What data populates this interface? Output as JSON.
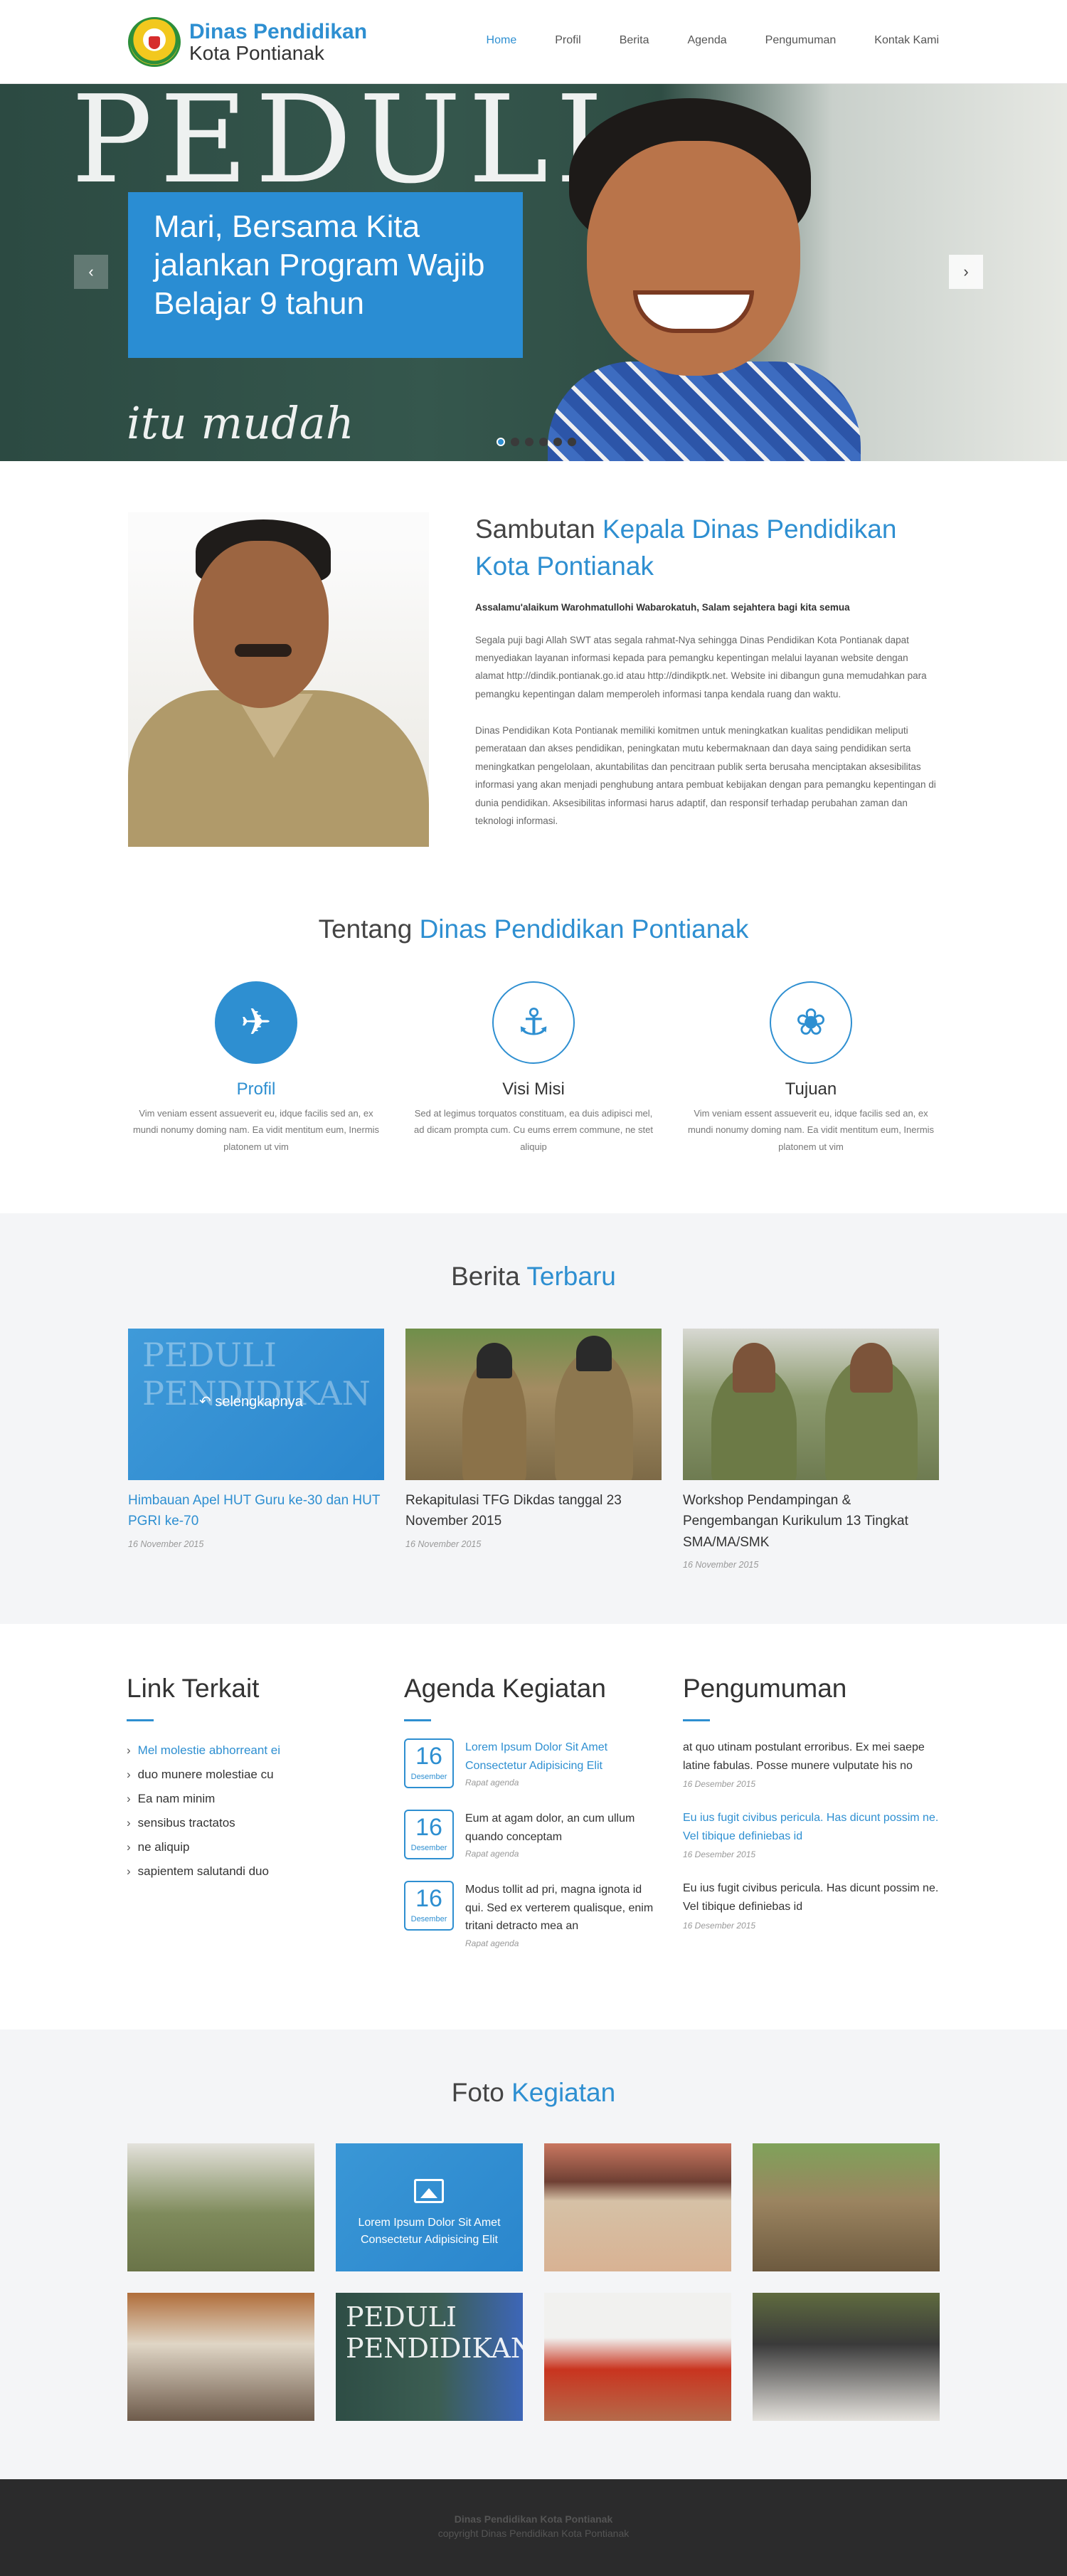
{
  "header": {
    "logo_title": "Dinas Pendidikan",
    "logo_sub": "Kota Pontianak",
    "nav": [
      {
        "label": "Home",
        "active": true
      },
      {
        "label": "Profil",
        "active": false
      },
      {
        "label": "Berita",
        "active": false
      },
      {
        "label": "Agenda",
        "active": false
      },
      {
        "label": "Pengumuman",
        "active": false
      },
      {
        "label": "Kontak Kami",
        "active": false
      }
    ]
  },
  "hero": {
    "caption": "Mari, Bersama Kita jalankan Program Wajib Belajar 9 tahun",
    "chalk_top": "PEDULI",
    "chalk_bottom": "itu mudah",
    "prev_icon": "chevron-left-icon",
    "next_icon": "chevron-right-icon",
    "slides": 6,
    "active_slide": 1
  },
  "welcome": {
    "title_plain": "Sambutan ",
    "title_blue": "Kepala Dinas Pendidikan Kota Pontianak",
    "greeting": "Assalamu'alaikum Warohmatullohi Wabarokatuh, Salam sejahtera bagi kita semua",
    "paragraph1": "Segala puji bagi Allah SWT atas segala rahmat-Nya sehingga Dinas Pendidikan Kota Pontianak dapat menyediakan layanan informasi kepada para pemangku kepentingan melalui layanan website dengan alamat http://dindik.pontianak.go.id atau http://dindikptk.net. Website ini dibangun guna memudahkan para pemangku kepentingan dalam memperoleh informasi tanpa kendala ruang dan waktu.",
    "paragraph2": "Dinas Pendidikan Kota Pontianak memiliki komitmen untuk meningkatkan kualitas pendidikan meliputi pemerataan dan akses pendidikan, peningkatan mutu kebermaknaan dan daya saing pendidikan serta meningkatkan pengelolaan, akuntabilitas dan pencitraan publik serta berusaha menciptakan aksesibilitas informasi yang akan menjadi penghubung antara pembuat kebijakan dengan para pemangku kepentingan di dunia pendidikan. Aksesibilitas informasi harus adaptif, dan responsif terhadap perubahan zaman dan teknologi informasi."
  },
  "tentang": {
    "title_plain": "Tentang ",
    "title_blue": "Dinas Pendidikan Pontianak",
    "items": [
      {
        "icon": "airplane-icon",
        "glyph": "✈",
        "title": "Profil",
        "text": "Vim veniam essent assueverit eu, idque facilis sed an, ex mundi nonumy doming nam. Ea vidit mentitum eum, Inermis platonem ut vim"
      },
      {
        "icon": "anchor-icon",
        "glyph": "⚓",
        "title": "Visi Misi",
        "text": "Sed at legimus torquatos constituam, ea duis adipisci mel, ad dicam prompta cum. Cu eums errem commune, ne stet aliquip"
      },
      {
        "icon": "bug-icon",
        "glyph": "❀",
        "title": "Tujuan",
        "text": "Vim veniam essent assueverit eu, idque facilis sed an, ex mundi nonumy doming nam. Ea vidit mentitum eum, Inermis platonem ut vim"
      }
    ]
  },
  "berita": {
    "title_plain": "Berita ",
    "title_blue": "Terbaru",
    "overlay_label": "selengkapnya",
    "items": [
      {
        "title": "Himbauan Apel HUT Guru ke-30 dan HUT PGRI ke-70",
        "date": "16 November 2015"
      },
      {
        "title": "Rekapitulasi TFG Dikdas tanggal 23 November 2015",
        "date": "16 November 2015"
      },
      {
        "title": "Workshop Pendampingan & Pengembangan Kurikulum 13 Tingkat SMA/MA/SMK",
        "date": "16 November 2015"
      }
    ]
  },
  "links": {
    "title": "Link Terkait",
    "items": [
      "Mel molestie abhorreant ei",
      "duo munere molestiae cu",
      "Ea nam minim",
      "sensibus tractatos",
      "ne aliquip",
      "sapientem salutandi duo"
    ]
  },
  "agenda": {
    "title": "Agenda Kegiatan",
    "items": [
      {
        "day": "16",
        "month": "Desember",
        "title": "Lorem Ipsum Dolor Sit Amet Consectetur Adipisicing Elit",
        "sub": "Rapat agenda"
      },
      {
        "day": "16",
        "month": "Desember",
        "title": "Eum at agam dolor, an cum ullum quando conceptam",
        "sub": "Rapat agenda"
      },
      {
        "day": "16",
        "month": "Desember",
        "title": "Modus tollit ad pri, magna ignota id qui. Sed ex verterem qualisque, enim tritani detracto mea an",
        "sub": "Rapat agenda"
      }
    ]
  },
  "pengumuman": {
    "title": "Pengumuman",
    "items": [
      {
        "text": "at quo utinam postulant erroribus. Ex mei saepe latine fabulas. Posse munere vulputate his no",
        "date": "16 Desember 2015"
      },
      {
        "text": "Eu ius fugit civibus pericula. Has dicunt possim ne. Vel tibique definiebas id",
        "date": "16 Desember 2015"
      },
      {
        "text": "Eu ius fugit civibus pericula. Has dicunt possim ne. Vel tibique definiebas id",
        "date": "16 Desember 2015"
      }
    ]
  },
  "foto": {
    "title_plain": "Foto ",
    "title_blue": "Kegiatan",
    "overlay_caption": "Lorem Ipsum Dolor Sit Amet Consectetur Adipisicing Elit",
    "chalk": "PEDULI PENDIDIKAN"
  },
  "footer": {
    "line1": "Dinas Pendidikan Kota Pontianak",
    "line2": "copyright Dinas Pendidikan Kota Pontianak"
  }
}
